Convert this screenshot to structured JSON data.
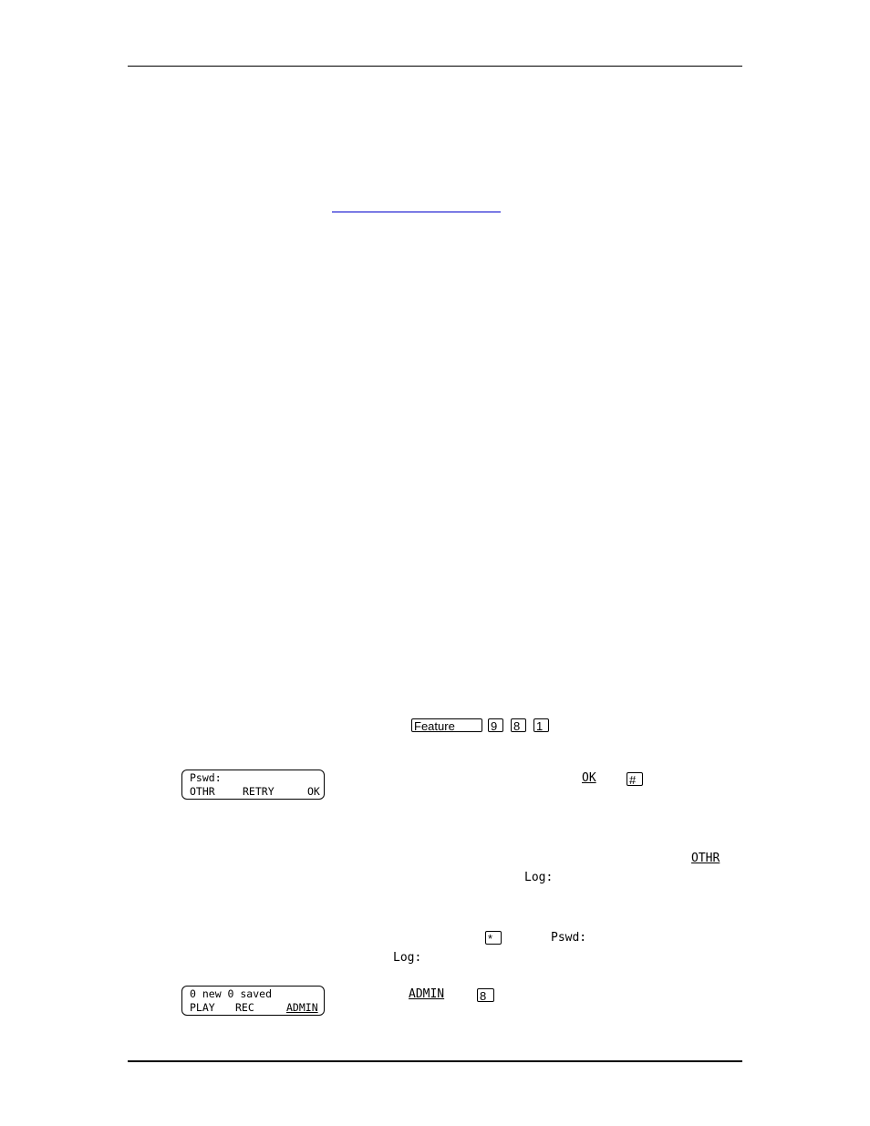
{
  "page": {
    "header_rule": true,
    "footer_rule": true,
    "link_color": "#0000cc"
  },
  "step_feature": {
    "feature_key": "Feature",
    "digits": [
      "9",
      "8",
      "1"
    ]
  },
  "lcd_password": {
    "line1": "Pswd:",
    "softkeys": [
      "OTHR",
      "RETRY",
      "OK"
    ]
  },
  "step_ok": {
    "softkey": "OK",
    "key": "#"
  },
  "step_othr": {
    "softkey": "OTHR",
    "prompt": "Log:"
  },
  "step_star": {
    "key": "*",
    "prompt1": "Pswd:",
    "prompt2": "Log:"
  },
  "lcd_mailbox": {
    "line1": "0 new 0 saved",
    "softkeys": [
      "PLAY",
      "REC",
      "ADMIN"
    ]
  },
  "step_admin": {
    "softkey": "ADMIN",
    "key": "8"
  }
}
